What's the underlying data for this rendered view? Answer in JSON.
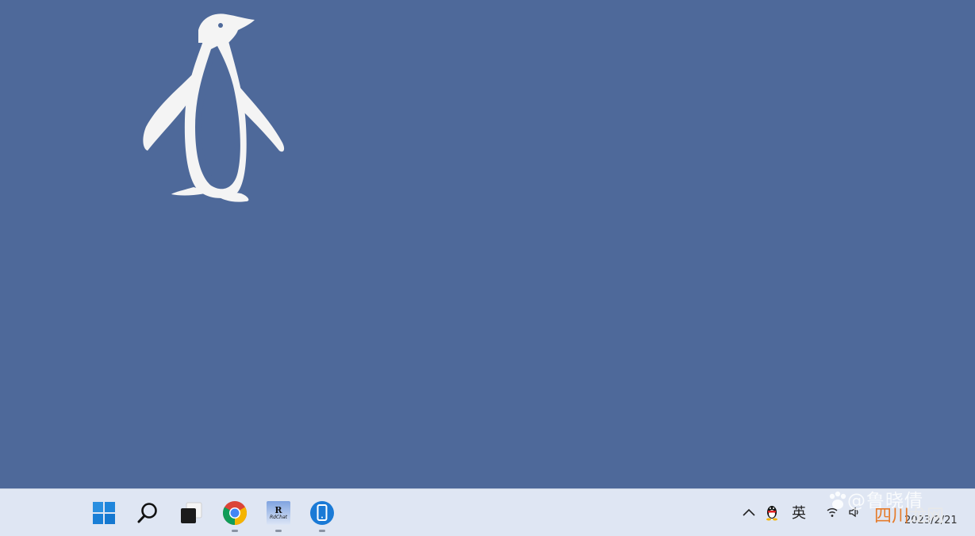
{
  "taskbar": {
    "apps": [
      {
        "id": "start",
        "name": "Start",
        "running": false
      },
      {
        "id": "search",
        "name": "Search",
        "running": false
      },
      {
        "id": "task-view",
        "name": "Task View",
        "running": false
      },
      {
        "id": "chrome",
        "name": "Google Chrome",
        "running": true
      },
      {
        "id": "rdchat",
        "name": "RdChat",
        "label_top": "R",
        "label_bottom": "RdChat",
        "running": true
      },
      {
        "id": "phone-link",
        "name": "Phone Link",
        "running": true
      }
    ]
  },
  "tray": {
    "show_hidden_icon": "chevron-up-icon",
    "qq_icon": "penguin-icon",
    "ime_label": "英",
    "network_icon": "network-icon",
    "volume_icon": "volume-icon"
  },
  "clock": {
    "date": "2023/2/21"
  },
  "watermark": {
    "line1": "@鲁晓倩",
    "line2_highlight": "四川",
    "line2_rest": "龙网"
  },
  "colors": {
    "desktop": "#4e699a",
    "taskbar": "#dfe6f3",
    "penguin": "#f4f4f4",
    "accent_blue": "#0a74d8"
  }
}
